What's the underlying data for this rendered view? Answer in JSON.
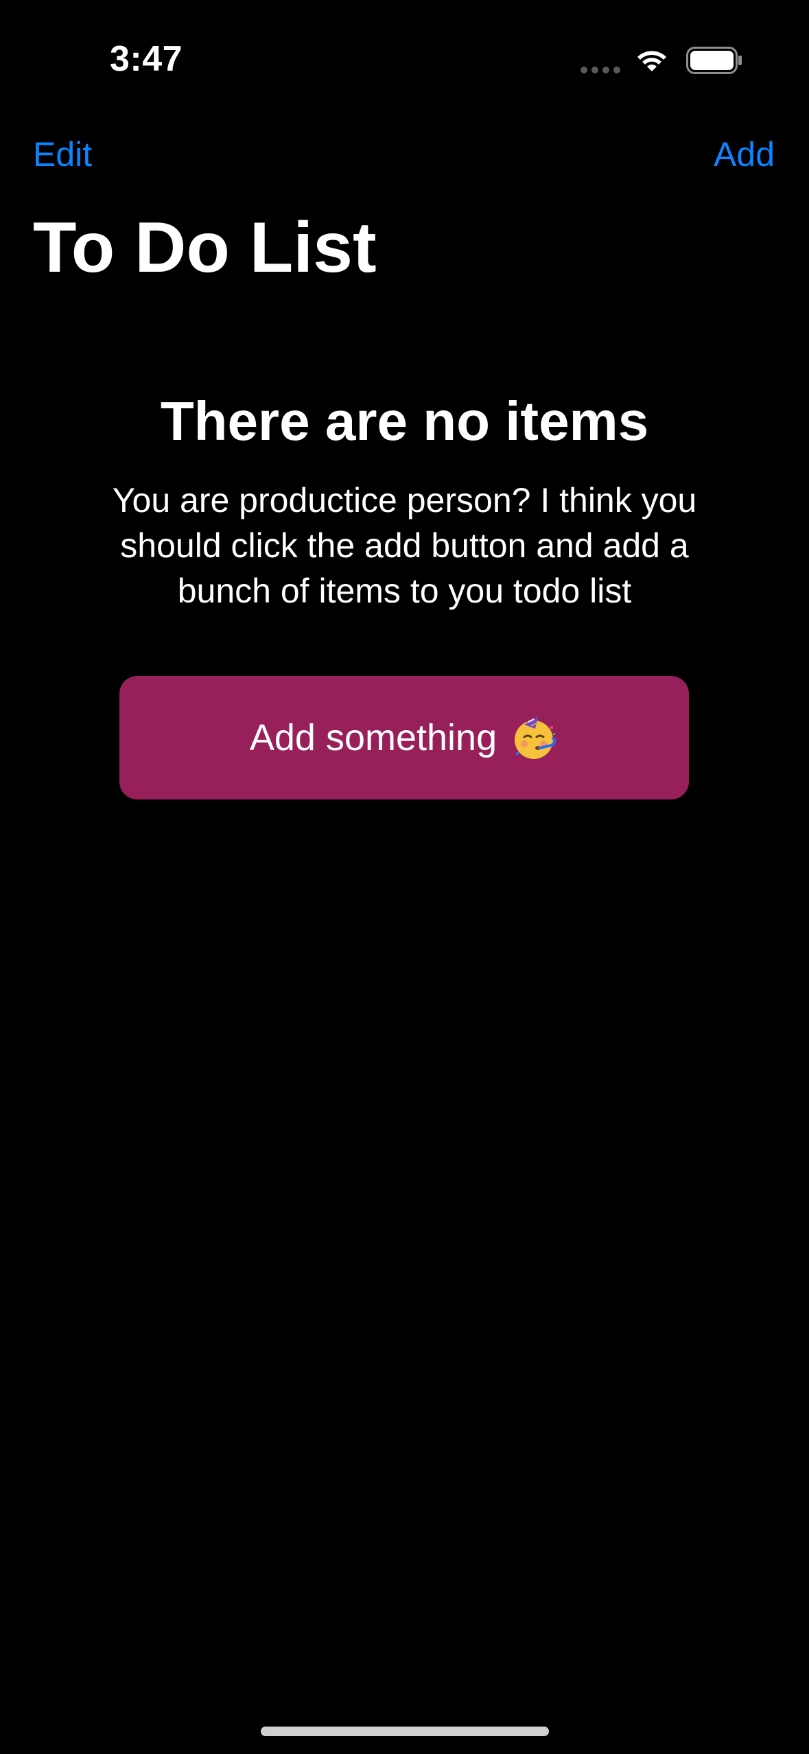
{
  "status_bar": {
    "time": "3:47",
    "icons": [
      "signal-dots-icon",
      "wifi-icon",
      "battery-icon"
    ]
  },
  "nav": {
    "edit_label": "Edit",
    "add_label": "Add",
    "title": "To Do List",
    "accent_color": "#0a84ff"
  },
  "empty_state": {
    "title": "There are no items",
    "description": "You are productice person? I think you should click the add button and add a bunch of items to you todo list",
    "button_label": "Add something",
    "button_icon": "partying-face-emoji-icon",
    "button_color": "#97205a"
  }
}
